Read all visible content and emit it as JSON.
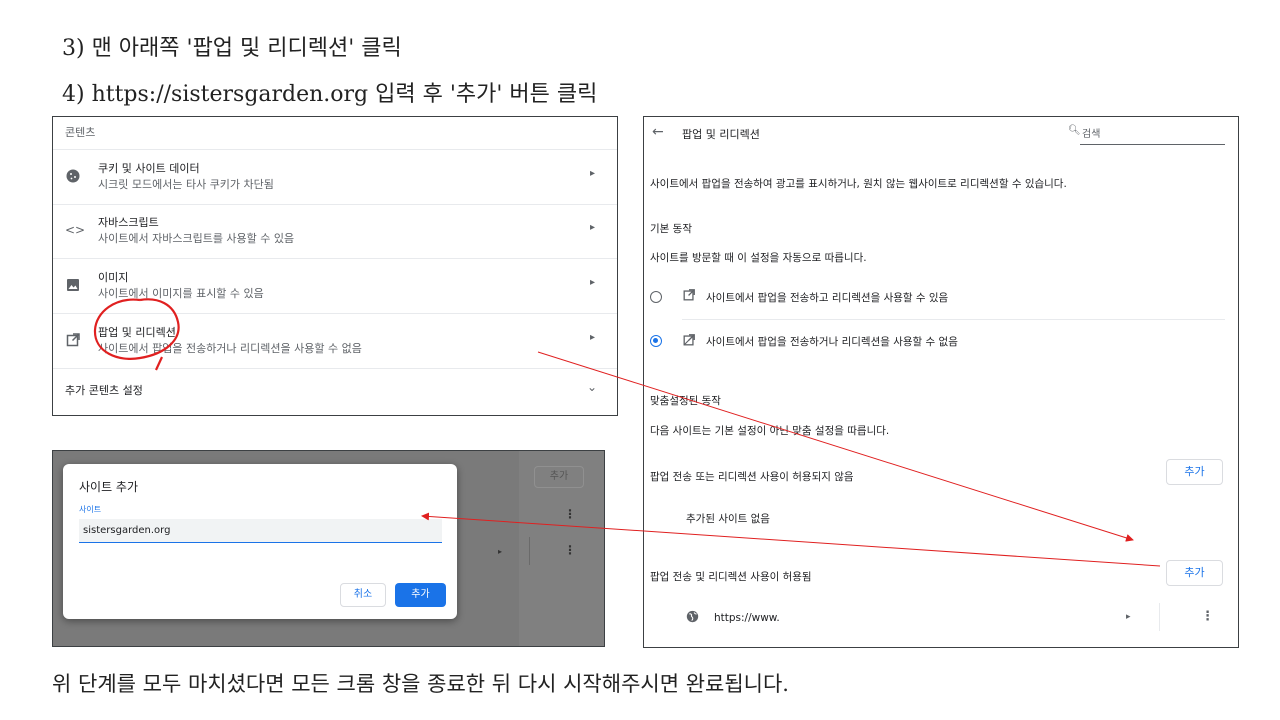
{
  "instructions": {
    "step3": "3) 맨 아래쪽 '팝업 및 리디렉션' 클릭",
    "step4": "4) https://sistersgarden.org 입력 후 '추가' 버튼 클릭",
    "footer": "위 단계를 모두 마치셨다면 모든 크롬 창을 종료한 뒤 다시 시작해주시면 완료됩니다."
  },
  "content_settings": {
    "header": "콘텐츠",
    "rows": [
      {
        "icon": "cookie-icon",
        "title": "쿠키 및 사이트 데이터",
        "subtitle": "시크릿 모드에서는 타사 쿠키가 차단됨"
      },
      {
        "icon": "code-icon",
        "title": "자바스크립트",
        "subtitle": "사이트에서 자바스크립트를 사용할 수 있음"
      },
      {
        "icon": "image-icon",
        "title": "이미지",
        "subtitle": "사이트에서 이미지를 표시할 수 있음"
      },
      {
        "icon": "open-in-new-icon",
        "title": "팝업 및 리디렉션",
        "subtitle": "사이트에서 팝업을 전송하거나 리디렉션을 사용할 수 없음"
      }
    ],
    "more": "추가 콘텐츠 설정"
  },
  "popups_page": {
    "title": "팝업 및 리디렉션",
    "search_placeholder": "검색",
    "description": "사이트에서 팝업을 전송하여 광고를 표시하거나, 원치 않는 웹사이트로 리디렉션할 수 있습니다.",
    "default_behavior": {
      "heading": "기본 동작",
      "subtitle": "사이트를 방문할 때 이 설정을 자동으로 따릅니다.",
      "option_allow": "사이트에서 팝업을 전송하고 리디렉션을 사용할 수 있음",
      "option_block": "사이트에서 팝업을 전송하거나 리디렉션을 사용할 수 없음",
      "selected": "block"
    },
    "custom": {
      "heading": "맞춤설정된 동작",
      "subtitle": "다음 사이트는 기본 설정이 아닌 맞춤 설정을 따릅니다.",
      "blocked_label": "팝업 전송 또는 리디렉션 사용이 허용되지 않음",
      "blocked_add": "추가",
      "blocked_empty": "추가된 사이트 없음",
      "allowed_label": "팝업 전송 및 리디렉션 사용이 허용됨",
      "allowed_add": "추가",
      "allowed_site": "https://www."
    }
  },
  "add_dialog": {
    "bg_add_button": "추가",
    "title": "사이트 추가",
    "field_label": "사이트",
    "field_value": "sistersgarden.org",
    "cancel": "취소",
    "add": "추가"
  },
  "colors": {
    "accent": "#1a73e8",
    "annotation": "#e02020"
  }
}
